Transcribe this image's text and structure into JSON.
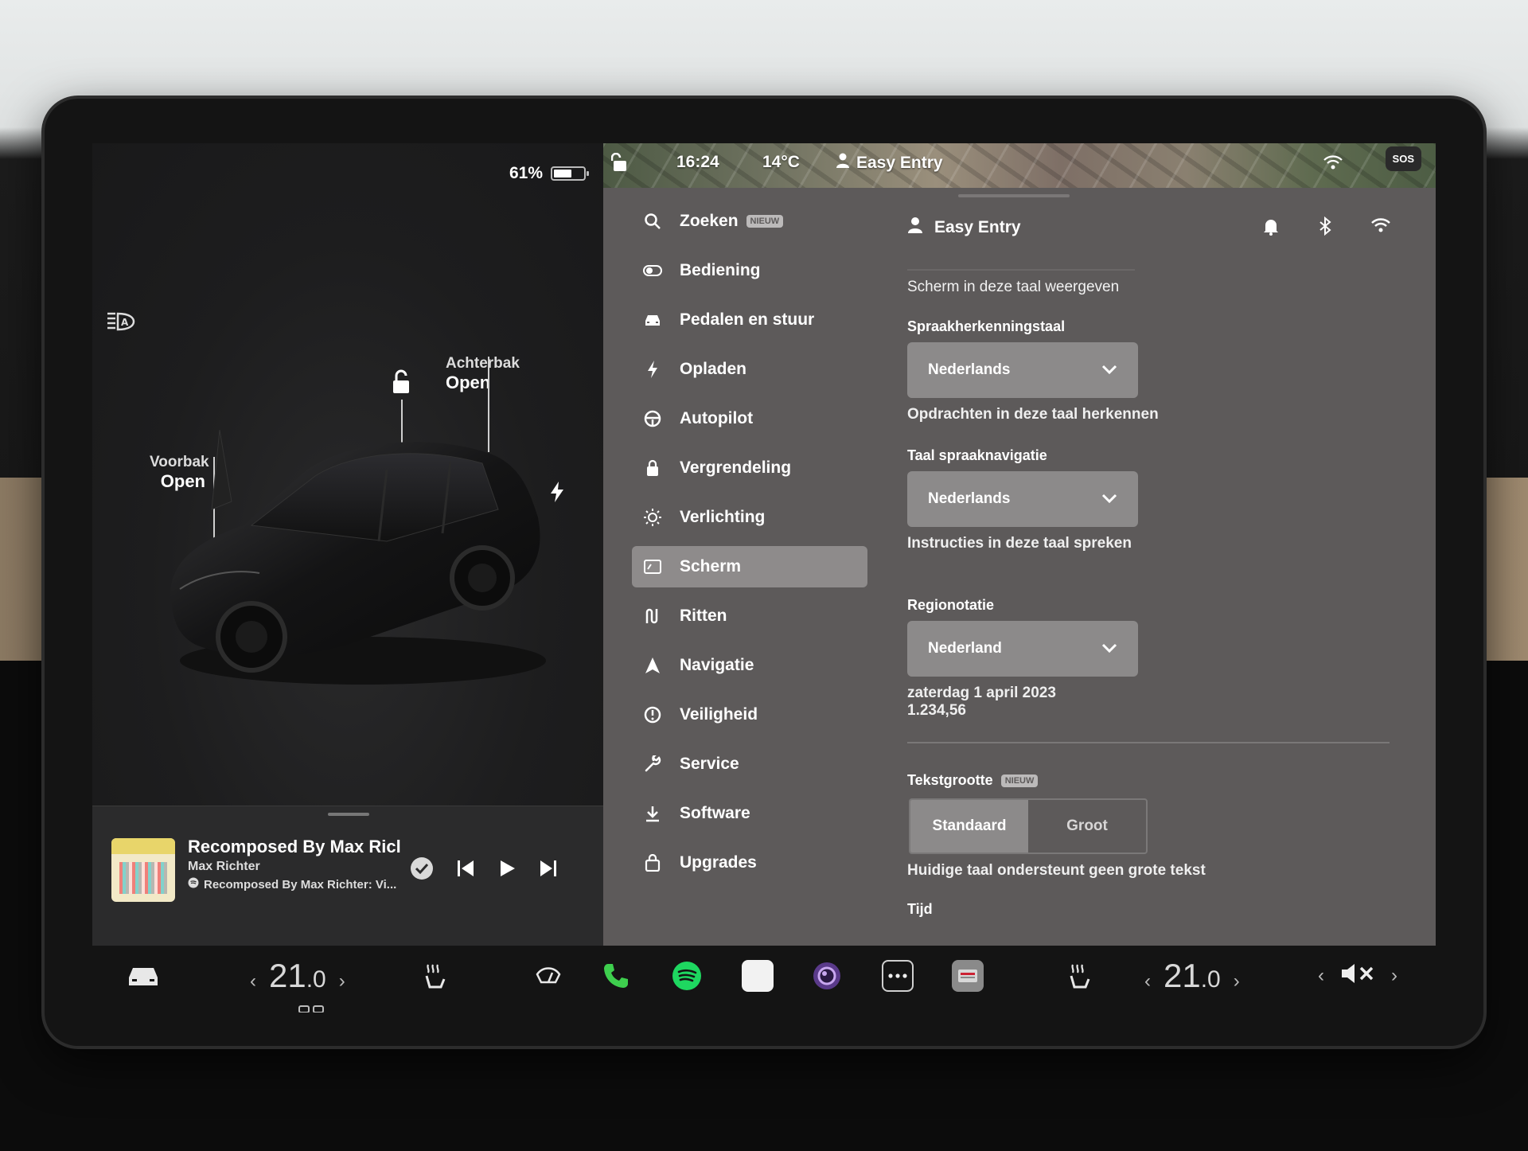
{
  "status_bar": {
    "battery": "61%",
    "battery_level": 0.61,
    "time": "16:24",
    "temperature": "14°C",
    "profile": "Easy Entry",
    "sos": "SOS"
  },
  "car": {
    "frunk_label": "Voorbak",
    "frunk_state": "Open",
    "trunk_label": "Achterbak",
    "trunk_state": "Open"
  },
  "media": {
    "title": "Recomposed By Max Ricl",
    "artist": "Max Richter",
    "album": "Recomposed By Max Richter: Vi..."
  },
  "nav": {
    "items": [
      {
        "label": "Zoeken",
        "icon": "search-icon",
        "badge": "NIEUW"
      },
      {
        "label": "Bediening",
        "icon": "toggle-icon"
      },
      {
        "label": "Pedalen en stuur",
        "icon": "car-icon"
      },
      {
        "label": "Opladen",
        "icon": "bolt-icon"
      },
      {
        "label": "Autopilot",
        "icon": "steering-wheel-icon"
      },
      {
        "label": "Vergrendeling",
        "icon": "lock-icon"
      },
      {
        "label": "Verlichting",
        "icon": "sun-icon"
      },
      {
        "label": "Scherm",
        "icon": "display-icon",
        "active": true
      },
      {
        "label": "Ritten",
        "icon": "trips-icon"
      },
      {
        "label": "Navigatie",
        "icon": "navigation-icon"
      },
      {
        "label": "Veiligheid",
        "icon": "alert-icon"
      },
      {
        "label": "Service",
        "icon": "wrench-icon"
      },
      {
        "label": "Software",
        "icon": "download-icon"
      },
      {
        "label": "Upgrades",
        "icon": "bag-icon"
      }
    ]
  },
  "settings": {
    "profile_name": "Easy Entry",
    "display_language_desc": "Scherm in deze taal weergeven",
    "speech_language_label": "Spraakherkenningstaal",
    "speech_language_value": "Nederlands",
    "speech_language_desc": "Opdrachten in deze taal herkennen",
    "voice_nav_label": "Taal spraaknavigatie",
    "voice_nav_value": "Nederlands",
    "voice_nav_desc": "Instructies in deze taal spreken",
    "region_label": "Regionotatie",
    "region_value": "Nederland",
    "region_date_example": "zaterdag 1 april 2023",
    "region_number_example": "1.234,56",
    "text_size_label": "Tekstgrootte",
    "text_size_badge": "NIEUW",
    "text_size_options": [
      "Standaard",
      "Groot"
    ],
    "text_size_selected": "Standaard",
    "text_size_note": "Huidige taal ondersteunt geen grote tekst",
    "time_label": "Tijd"
  },
  "bottom_bar": {
    "driver_temp_int": "21",
    "driver_temp_dec": ".0",
    "passenger_temp_int": "21",
    "passenger_temp_dec": ".0",
    "volume_state": "muted"
  },
  "colors": {
    "settings_bg": "#5d5a5a",
    "active_item": "#8e8b8b",
    "dropdown": "#8c8a8a",
    "phone_green": "#3ecf4e",
    "spotify_green": "#1ed760"
  }
}
